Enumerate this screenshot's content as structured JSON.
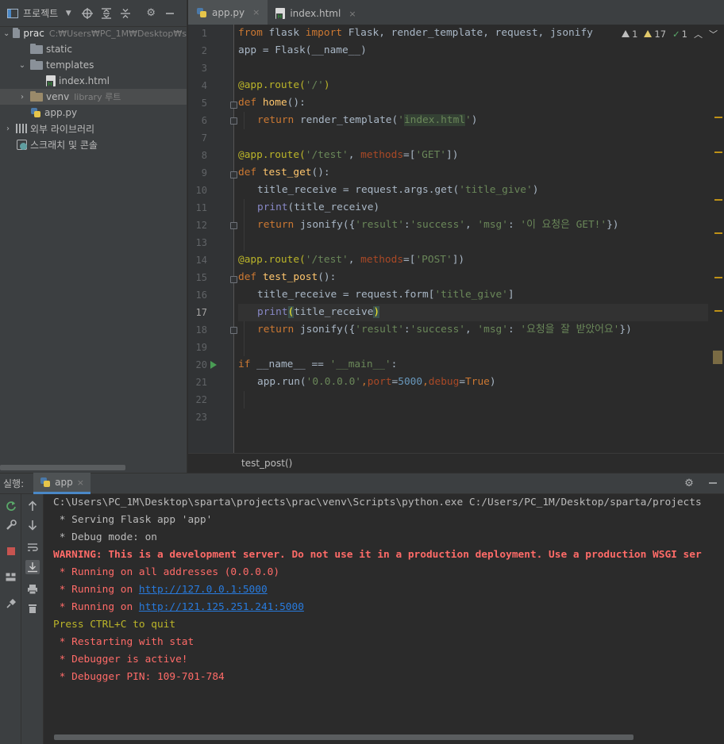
{
  "project": {
    "title": "프로젝트",
    "tree": [
      {
        "label": "prac",
        "sub": "C:₩Users₩PC_1M₩Desktop₩s"
      },
      {
        "label": "static"
      },
      {
        "label": "templates"
      },
      {
        "label": "index.html"
      },
      {
        "label": "venv",
        "sub": "library 루트"
      },
      {
        "label": "app.py"
      },
      {
        "label": "외부 라이브러리"
      },
      {
        "label": "스크래치 및 콘솔"
      }
    ]
  },
  "editor": {
    "tabs": [
      {
        "label": "app.py",
        "close": "×"
      },
      {
        "label": "index.html",
        "close": "×"
      }
    ],
    "line_numbers": [
      "1",
      "2",
      "3",
      "4",
      "5",
      "6",
      "7",
      "8",
      "9",
      "10",
      "11",
      "12",
      "13",
      "14",
      "15",
      "16",
      "17",
      "18",
      "19",
      "20",
      "21",
      "22",
      "23"
    ],
    "current_line": "17",
    "inspections": {
      "weak_warnings": "1",
      "warnings": "17",
      "typos": "1"
    },
    "breadcrumb": "test_post()",
    "code": {
      "l1": [
        "from",
        " flask ",
        "import",
        " Flask, render_template, request, jsonify"
      ],
      "l2": "app = Flask(__name__)",
      "l4": [
        "@app.route(",
        "'/'",
        ")"
      ],
      "l5": [
        "def",
        " ",
        "home",
        "():"
      ],
      "l6": [
        "return",
        " render_template(",
        "'",
        "index.html",
        "'",
        ")"
      ],
      "l8": [
        "@app.route(",
        "'/test'",
        ", ",
        "methods",
        "=[",
        "'GET'",
        "])"
      ],
      "l9": [
        "def",
        " ",
        "test_get",
        "():"
      ],
      "l10": [
        "title_receive = request.args.get(",
        "'title_give'",
        ")"
      ],
      "l11": [
        "print",
        "(title_receive)"
      ],
      "l12": [
        "return",
        " jsonify({",
        "'result'",
        ":",
        "'success'",
        ", ",
        "'msg'",
        ": ",
        "'이 요청은 GET!'",
        "})"
      ],
      "l14": [
        "@app.route(",
        "'/test'",
        ", ",
        "methods",
        "=[",
        "'POST'",
        "])"
      ],
      "l15": [
        "def",
        " ",
        "test_post",
        "():"
      ],
      "l16": [
        "title_receive = request.form[",
        "'title_give'",
        "]"
      ],
      "l17": [
        "print",
        "(",
        "title_receive",
        ")"
      ],
      "l18": [
        "return",
        " jsonify({",
        "'result'",
        ":",
        "'success'",
        ", ",
        "'msg'",
        ": ",
        "'요청을 잘 받았어요'",
        "})"
      ],
      "l20": [
        "if",
        " __name__ == ",
        "'__main__'",
        ":"
      ],
      "l21": [
        "app.run(",
        "'0.0.0.0'",
        ",",
        "port",
        "=",
        "5000",
        ",",
        "debug",
        "=",
        "True",
        ")"
      ]
    }
  },
  "run": {
    "label": "실행:",
    "tab": "app",
    "tab_close": "×",
    "console": [
      "C:\\Users\\PC_1M\\Desktop\\sparta\\projects\\prac\\venv\\Scripts\\python.exe C:/Users/PC_1M/Desktop/sparta/projects",
      " * Serving Flask app 'app'",
      " * Debug mode: on",
      "WARNING: This is a development server. Do not use it in a production deployment. Use a production WSGI ser",
      " * Running on all addresses (0.0.0.0)",
      " * Running on ",
      "http://127.0.0.1:5000",
      " * Running on ",
      "http://121.125.251.241:5000",
      "Press CTRL+C to quit",
      " * Restarting with stat",
      " * Debugger is active!",
      " * Debugger PIN: 109-701-784"
    ]
  },
  "colors": {
    "accent": "#4a88c7",
    "background": "#2b2b2b",
    "panel": "#3c3f41"
  }
}
